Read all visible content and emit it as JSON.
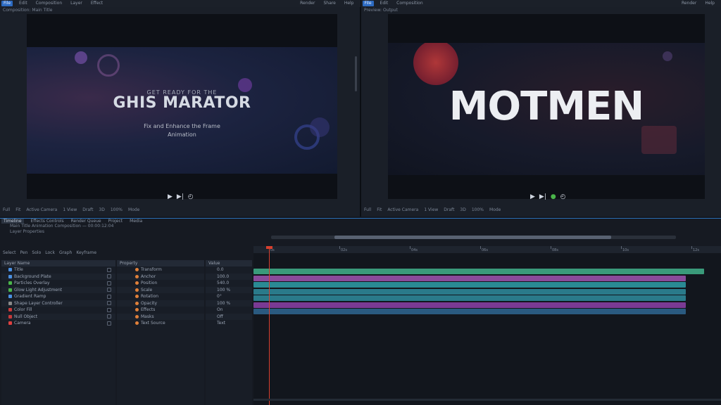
{
  "menubar": {
    "left": [
      "File",
      "Edit",
      "Composition",
      "Layer",
      "Effect"
    ],
    "right": [
      "Render",
      "Share",
      "Help"
    ]
  },
  "viewer_left": {
    "head": "Composition: Main Title",
    "kicker": "GET READY FOR THE",
    "headline": "GHIS MARATOR",
    "subline1": "Fix and Enhance the Frame",
    "subline2": "Animation",
    "transport": [
      "▶",
      "▶|",
      "◴"
    ],
    "footer": [
      "Full",
      "Fit",
      "Active Camera",
      "1 View",
      "Draft",
      "3D",
      "100%",
      "Mode"
    ]
  },
  "viewer_right": {
    "head": "Preview: Output",
    "headline": "MOTMEN",
    "transport": [
      "▶",
      "▶|",
      "●",
      "◴"
    ],
    "footer": [
      "Full",
      "Fit",
      "Active Camera",
      "1 View",
      "Draft",
      "3D",
      "100%",
      "Mode"
    ]
  },
  "lower": {
    "tabs": [
      "Timeline",
      "Effects Controls",
      "Render Queue",
      "Project",
      "Media"
    ],
    "subline1": "Main Title Animation Composition — 00:00:12:04",
    "subline2": "Layer Properties",
    "tools": [
      "Select",
      "Pen",
      "Solo",
      "Lock",
      "Graph",
      "Keyframe"
    ],
    "progress_fraction": 0.84
  },
  "layers": {
    "header": "Layer Name",
    "rows": [
      {
        "name": "Title",
        "color": "#4a90e2"
      },
      {
        "name": "Background Plate",
        "color": "#4a90e2"
      },
      {
        "name": "Particles Overlay",
        "color": "#4ab54a"
      },
      {
        "name": "Glow Light Adjustment",
        "color": "#4ab54a"
      },
      {
        "name": "Gradient Ramp",
        "color": "#4a90e2"
      },
      {
        "name": "Shape Layer Controller",
        "color": "#8a8a8a"
      },
      {
        "name": "Color Fill",
        "color": "#c83a3a"
      },
      {
        "name": "Null Object",
        "color": "#c83a3a"
      },
      {
        "name": "Camera",
        "color": "#e04040"
      }
    ]
  },
  "props": {
    "header": "Property",
    "rows": [
      "Transform",
      "Anchor",
      "Position",
      "Scale",
      "Rotation",
      "Opacity",
      "Effects",
      "Masks",
      "Text Source"
    ]
  },
  "vals": {
    "header": "Value",
    "rows": [
      "0.0",
      "100.0",
      "540.0",
      "100 %",
      "0°",
      "100 %",
      "On",
      "Off",
      "Text"
    ]
  },
  "timeline": {
    "ruler_labels": [
      "0s",
      "02s",
      "04s",
      "06s",
      "08s",
      "10s",
      "12s"
    ],
    "tracks": [
      {
        "color": "#3a9a7a",
        "start": 0.0,
        "end": 1.0
      },
      {
        "color": "#8a4a9a",
        "start": 0.0,
        "end": 0.96
      },
      {
        "color": "#2a8a94",
        "start": 0.0,
        "end": 0.96
      },
      {
        "color": "#2a7a8a",
        "start": 0.0,
        "end": 0.96
      },
      {
        "color": "#2a7a8a",
        "start": 0.0,
        "end": 0.96
      },
      {
        "color": "#7a3a94",
        "start": 0.0,
        "end": 0.96
      },
      {
        "color": "#2a5a80",
        "start": 0.0,
        "end": 0.96
      }
    ],
    "playhead_time": "00:00:00:12"
  },
  "colors": {
    "accent": "#2d6bc2",
    "playhead": "#d8402e"
  }
}
